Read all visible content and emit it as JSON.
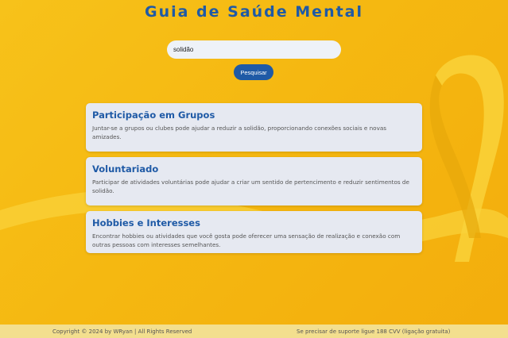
{
  "colors": {
    "accent": "#1f5aa6",
    "background": "#f5b811",
    "card": "#e6e9f1",
    "footer": "#f3df8e"
  },
  "header": {
    "title": "Guia de Saúde Mental"
  },
  "search": {
    "value": "solidão",
    "button_label": "Pesquisar"
  },
  "results": [
    {
      "title": "Participação em Grupos",
      "text": "Juntar-se a grupos ou clubes pode ajudar a reduzir a solidão, proporcionando conexões sociais e novas amizades."
    },
    {
      "title": "Voluntariado",
      "text": "Participar de atividades voluntárias pode ajudar a criar um sentido de pertencimento e reduzir sentimentos de solidão."
    },
    {
      "title": "Hobbies e Interesses",
      "text": "Encontrar hobbies ou atividades que você gosta pode oferecer uma sensação de realização e conexão com outras pessoas com interesses semelhantes."
    }
  ],
  "footer": {
    "copyright": "Copyright © 2024 by WRyan | All Rights Reserved",
    "support": "Se precisar de suporte ligue 188 CVV (ligação gratuita)"
  }
}
